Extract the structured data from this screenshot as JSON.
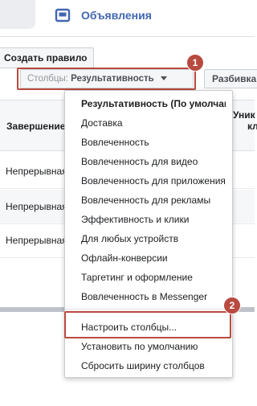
{
  "colors": {
    "accent": "#4267b2",
    "callout": "#b94a40"
  },
  "ads_tab": {
    "icon": "ads-manager-icon",
    "title": "Объявления"
  },
  "toolbar": {
    "create_rule_label": "Создать правило",
    "columns_label": "Столбцы:",
    "columns_value": "Результативность",
    "breakdown_label": "Разбивка"
  },
  "table": {
    "headers": {
      "end": "Завершение",
      "unique_line1": "Уник",
      "unique_line2": "кл"
    },
    "rows": [
      "Непрерывная",
      "Непрерывная",
      "Непрерывная"
    ]
  },
  "columns_menu": {
    "presets": [
      {
        "label": "Результативность (По умолчанию)",
        "selected": true
      },
      {
        "label": "Доставка",
        "selected": false
      },
      {
        "label": "Вовлеченность",
        "selected": false
      },
      {
        "label": "Вовлеченность для видео",
        "selected": false
      },
      {
        "label": "Вовлеченность для приложения",
        "selected": false
      },
      {
        "label": "Вовлеченность для рекламы",
        "selected": false
      },
      {
        "label": "Эффективность и клики",
        "selected": false
      },
      {
        "label": "Для любых устройств",
        "selected": false
      },
      {
        "label": "Офлайн-конверсии",
        "selected": false
      },
      {
        "label": "Таргетинг и оформление",
        "selected": false
      },
      {
        "label": "Вовлеченность в Messenger",
        "selected": false
      }
    ],
    "actions": [
      {
        "label": "Настроить столбцы..."
      },
      {
        "label": "Установить по умолчанию"
      },
      {
        "label": "Сбросить ширину столбцов"
      }
    ]
  },
  "callouts": [
    "1",
    "2"
  ]
}
